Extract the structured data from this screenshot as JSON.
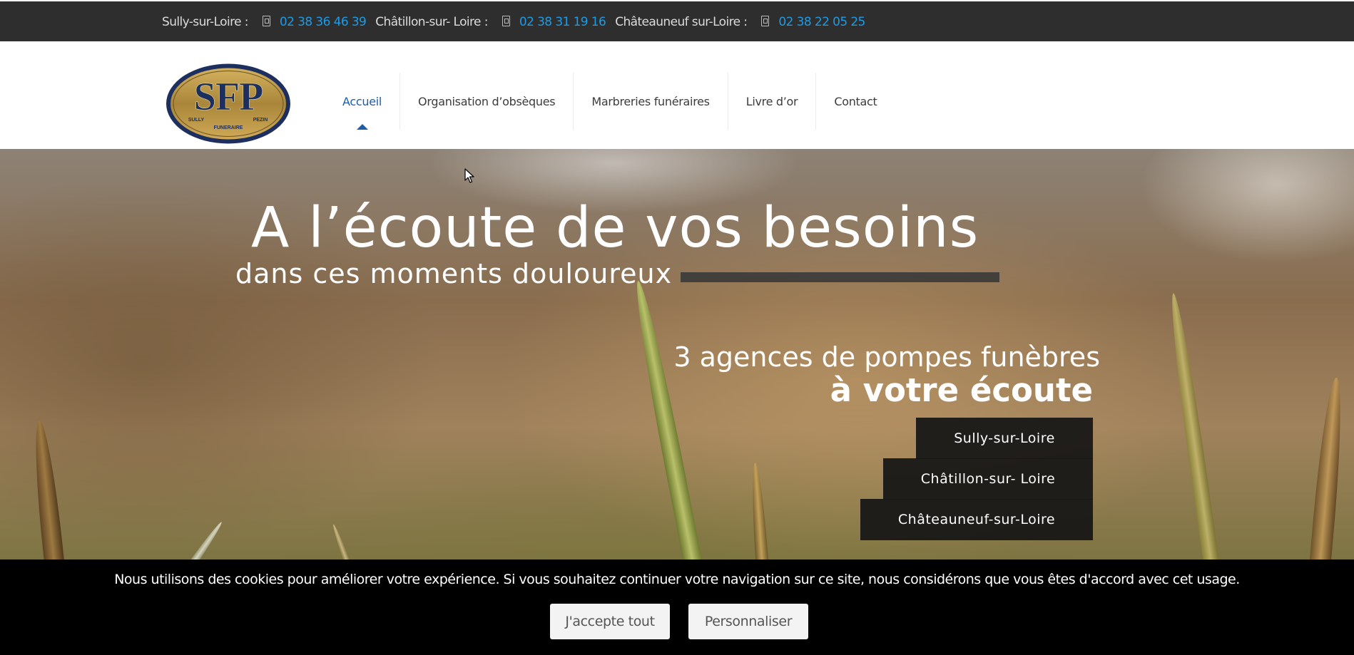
{
  "topbar": {
    "contacts": [
      {
        "city": "Sully-sur-Loire :",
        "phone": "02 38 36 46 39"
      },
      {
        "city": "Châtillon-sur- Loire :",
        "phone": "02 38 31 19 16"
      },
      {
        "city": "Châteauneuf sur-Loire :",
        "phone": "02 38 22 05 25"
      }
    ]
  },
  "logo": {
    "monogram": "SFP",
    "left_text": "SULLY",
    "right_text": "PEZIN",
    "bottom_text": "FUNERAIRE"
  },
  "nav": {
    "items": [
      {
        "label": "Accueil",
        "active": true
      },
      {
        "label": "Organisation d’obsèques"
      },
      {
        "label": "Marbreries funéraires"
      },
      {
        "label": "Livre d’or"
      },
      {
        "label": "Contact"
      }
    ]
  },
  "hero": {
    "headline": "A l’écoute de vos besoins",
    "subheadline": "dans ces moments douloureux",
    "tagline_line1": "3 agences de pompes funèbres",
    "tagline_line2": "à votre écoute",
    "agencies": [
      "Sully-sur-Loire",
      "Châtillon-sur- Loire",
      "Châteauneuf-sur-Loire"
    ]
  },
  "cookie": {
    "message": "Nous utilisons des cookies pour améliorer votre expérience. Si vous souhaitez continuer votre navigation sur ce site, nous considérons que vous êtes d'accord avec cet usage.",
    "accept_label": "J'accepte tout",
    "customize_label": "Personnaliser"
  },
  "colors": {
    "topbar_bg": "#2e2e2e",
    "phone_link": "#1e9be5",
    "nav_active": "#1c5fa8",
    "logo_gold": "#b8923e",
    "logo_navy": "#1c2f5e"
  }
}
